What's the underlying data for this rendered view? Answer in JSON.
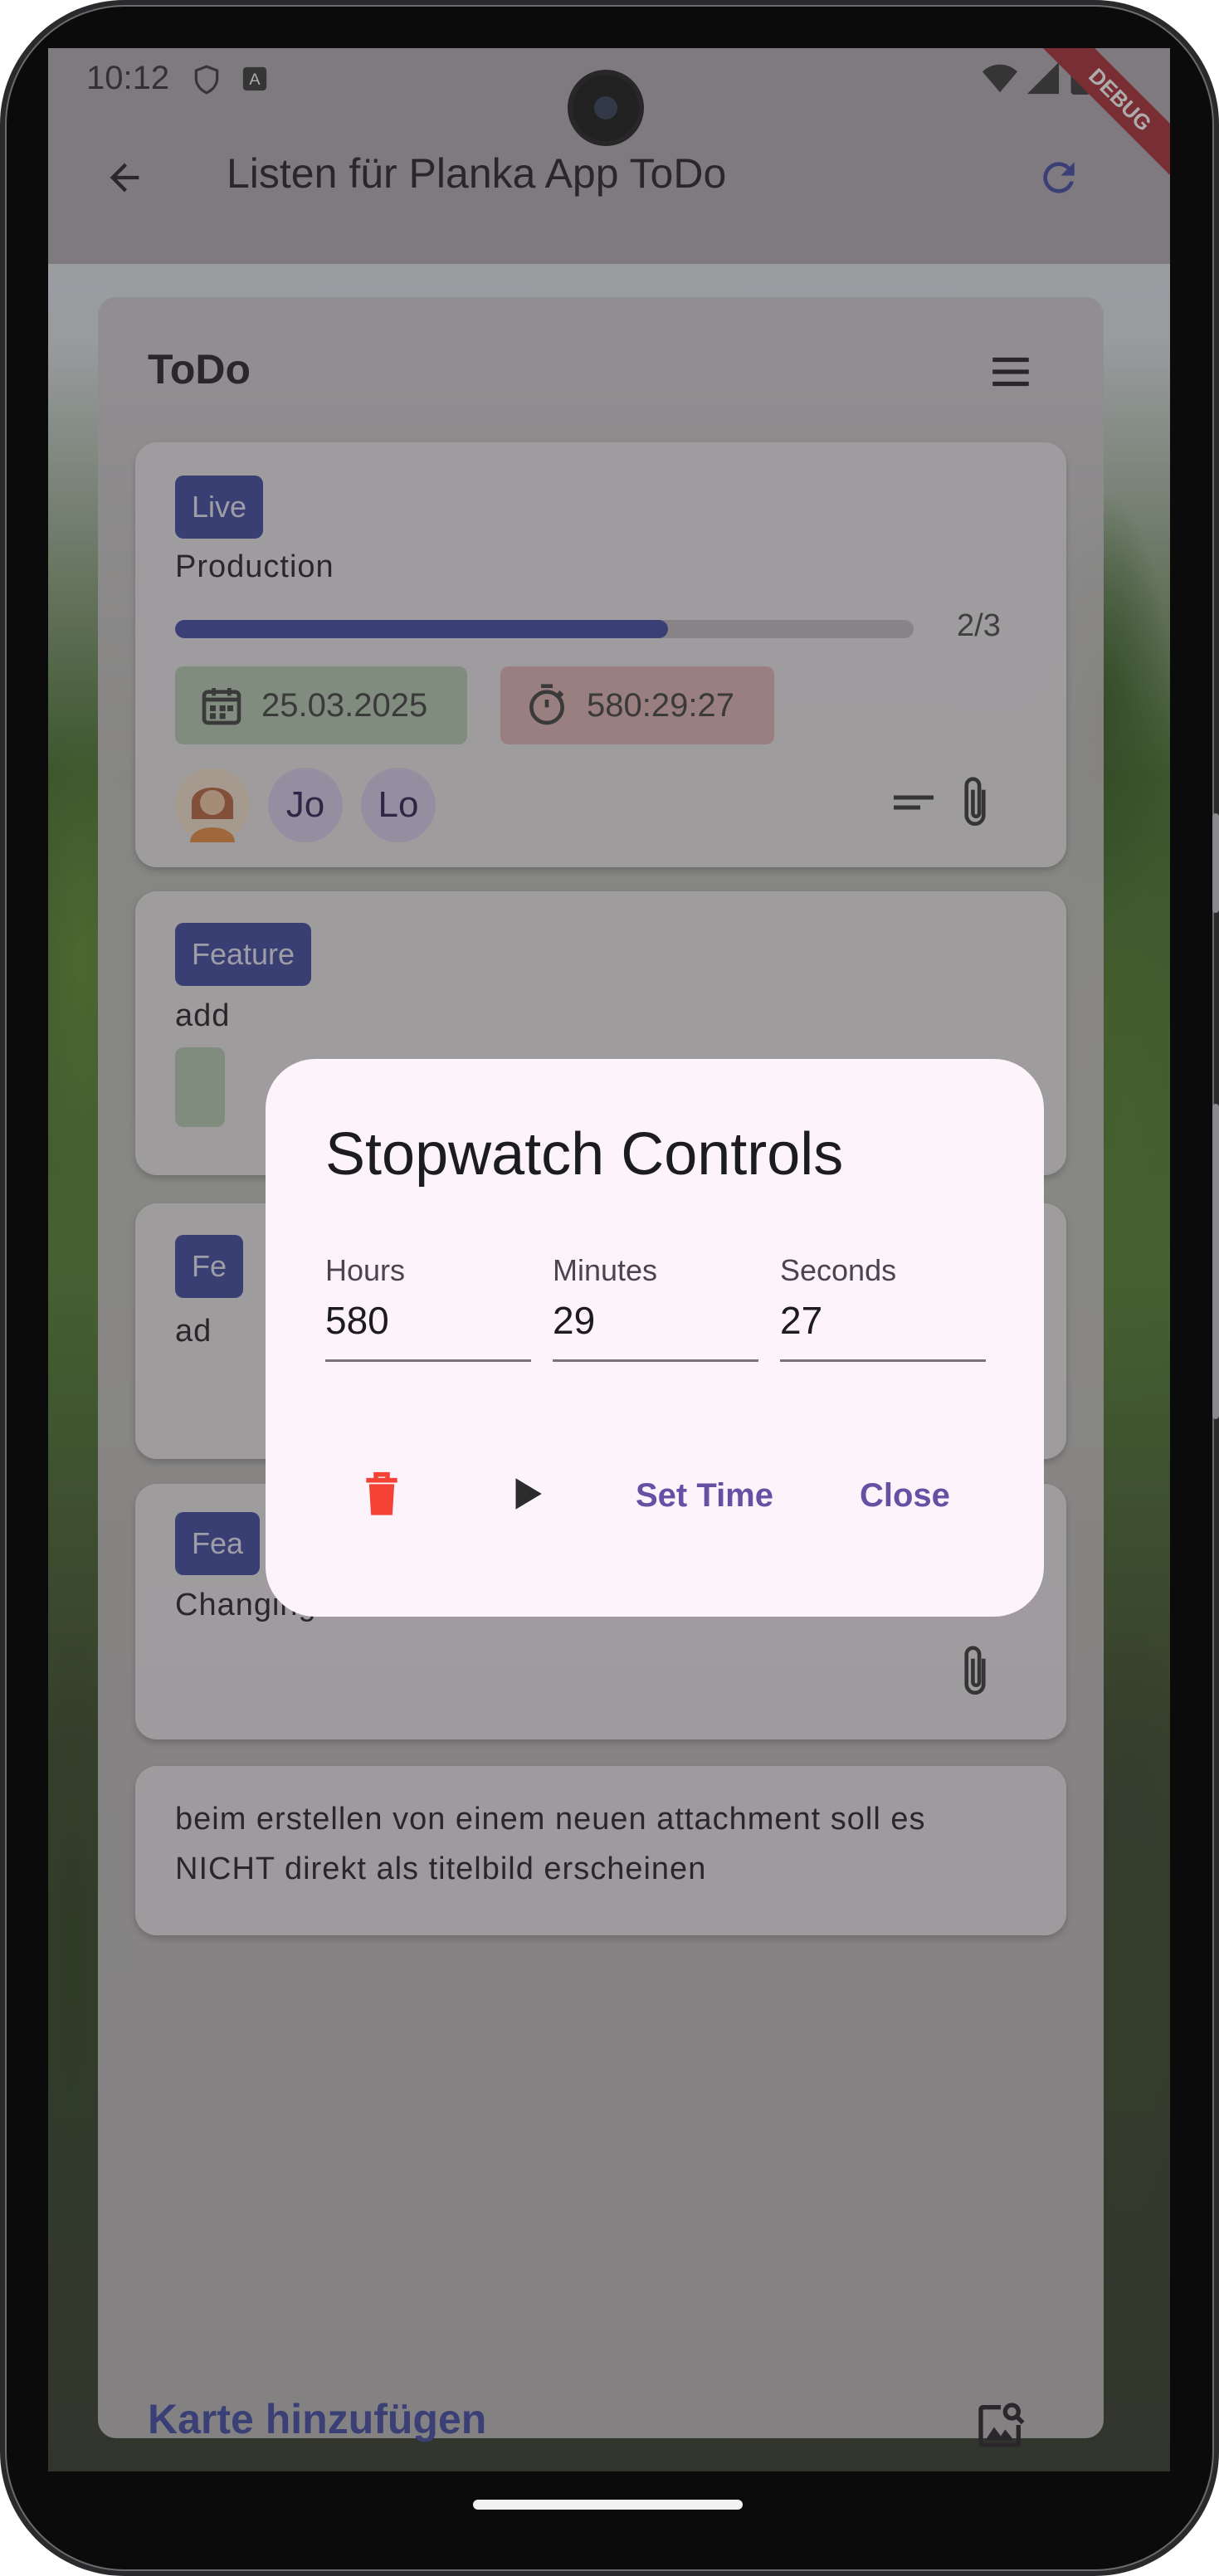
{
  "status_bar": {
    "time": "10:12"
  },
  "debug_banner": "DEBUG",
  "app_bar": {
    "title": "Listen für Planka App ToDo"
  },
  "list": {
    "title": "ToDo",
    "cards": [
      {
        "label": "Live",
        "title": "Production",
        "tasks_progress": "2/3",
        "tasks_fraction": 0.667,
        "due_date": "25.03.2025",
        "stopwatch": "580:29:27",
        "members": [
          "Jo",
          "Lo"
        ]
      },
      {
        "label": "Feature",
        "title_partial": "add"
      },
      {
        "label_partial": "Fe",
        "title_partial": "ad"
      },
      {
        "label_partial": "Fea",
        "title": "Changing dueDate and Timer inside fCard."
      },
      {
        "title_line1": "beim erstellen von einem neuen attachment soll es",
        "title_line2": "NICHT direkt als titelbild erscheinen"
      }
    ],
    "add_card_label": "Karte hinzufügen"
  },
  "dialog": {
    "title": "Stopwatch Controls",
    "fields": [
      {
        "label": "Hours",
        "value": "580"
      },
      {
        "label": "Minutes",
        "value": "29"
      },
      {
        "label": "Seconds",
        "value": "27"
      }
    ],
    "set_time_label": "Set Time",
    "close_label": "Close"
  },
  "colors": {
    "label_chip": "#38449a",
    "progress": "#3a45a0",
    "dialog_bg": "#fcf3fb",
    "action": "#6650a4",
    "delete": "#f44336"
  }
}
